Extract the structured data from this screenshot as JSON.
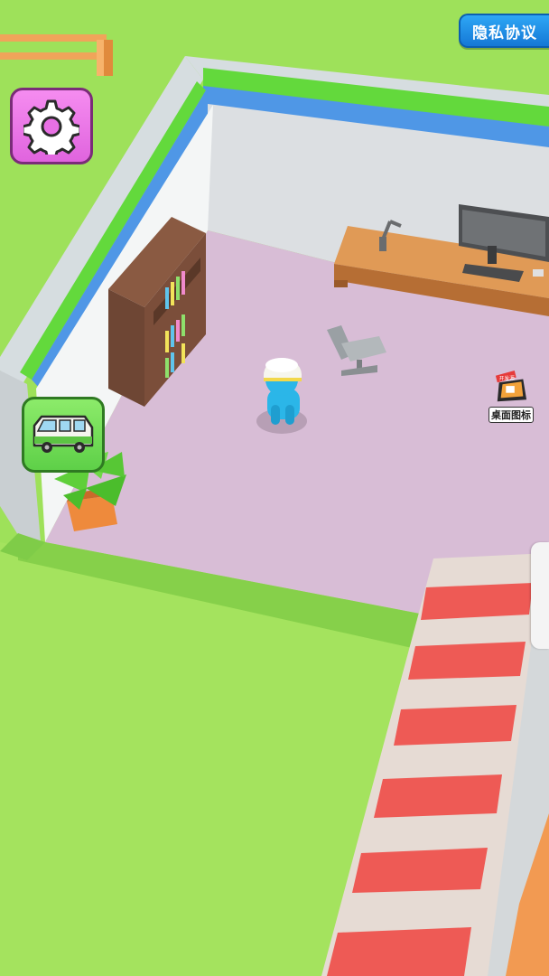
{
  "hud": {
    "privacy_label": "隐私协议",
    "desktop_icon_label": "桌面图标",
    "desktop_icon_ribbon": "开发源"
  },
  "icons": {
    "settings": "gear-icon",
    "vehicle": "van-icon",
    "desktop": "pc-icon"
  },
  "colors": {
    "grass": "#9ee15a",
    "floor": "#d8bdd6",
    "wall_trim_green": "#63d93c",
    "wall_trim_blue": "#4f97e6",
    "settings_button": "#e87ae6",
    "van_button": "#6fdd52",
    "privacy_button": "#1f8fe8",
    "stripe_red": "#ee5a55"
  }
}
